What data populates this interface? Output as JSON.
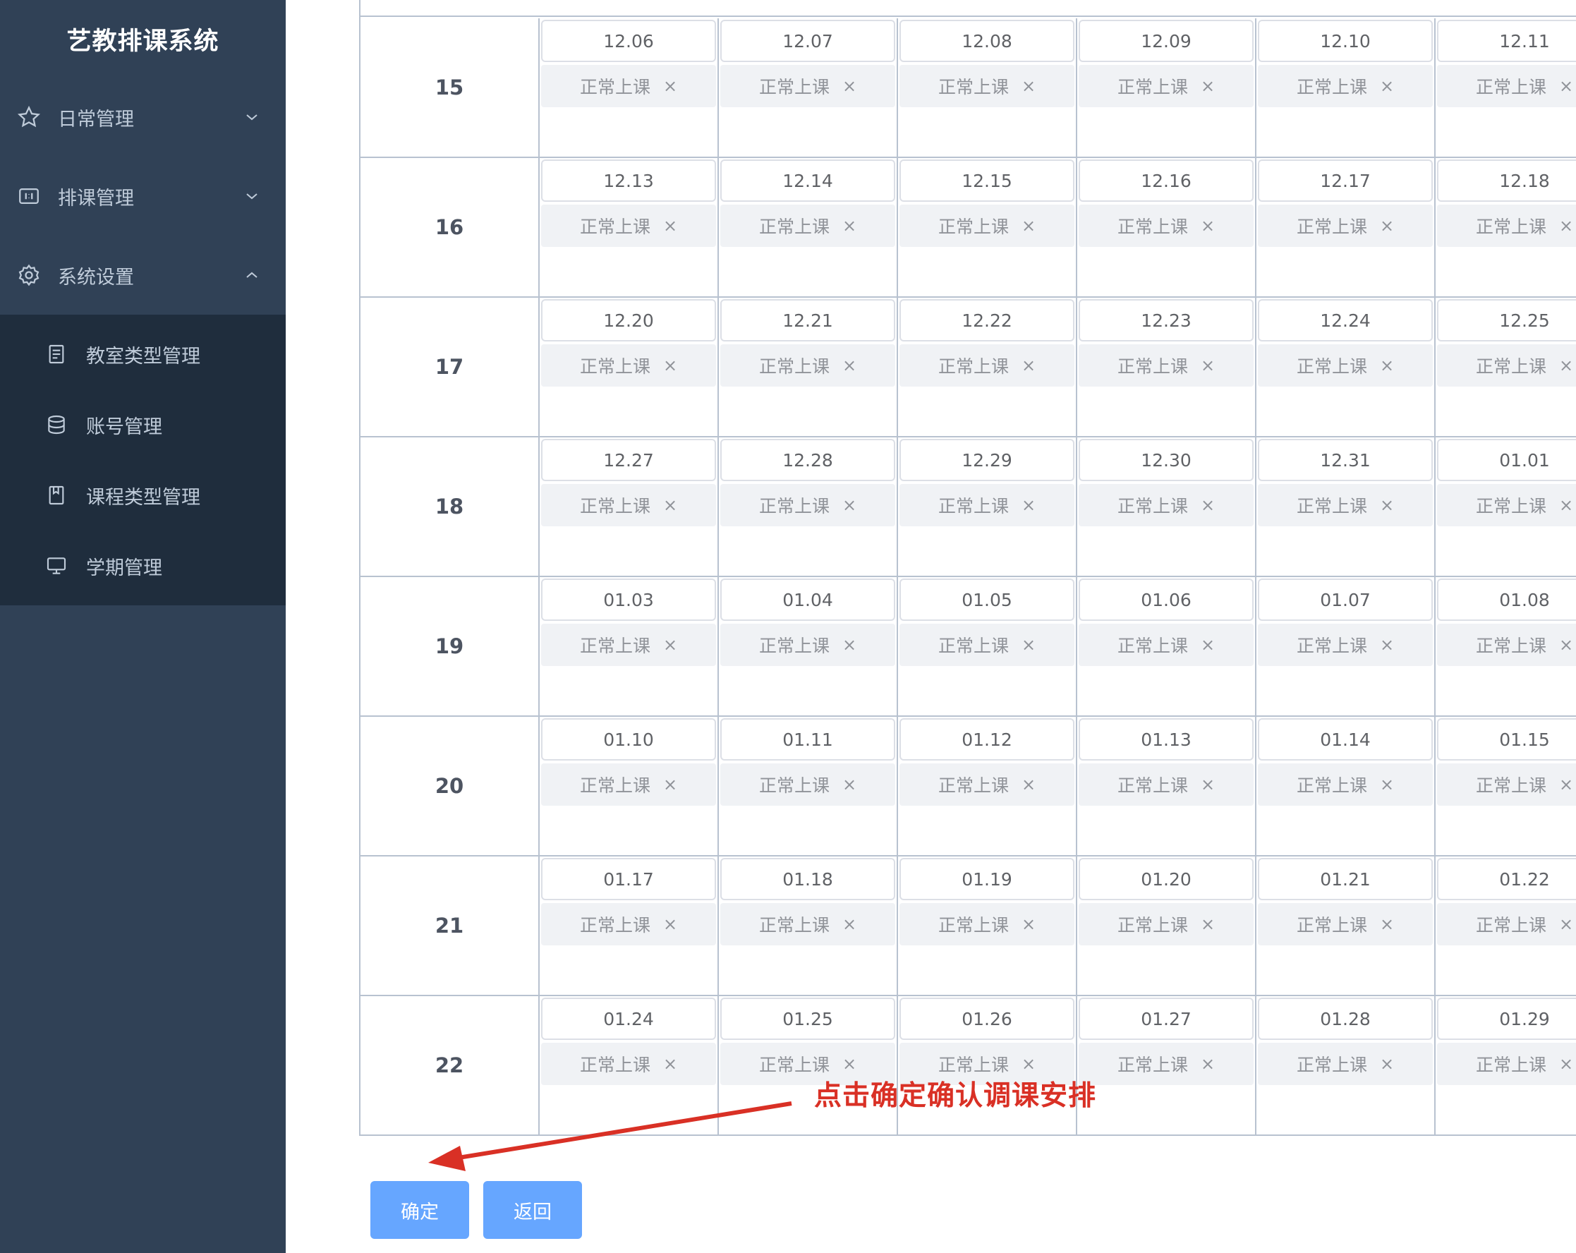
{
  "app": {
    "title": "艺教排课系统"
  },
  "sidebar": {
    "menus": [
      {
        "label": "日常管理",
        "icon": "star-icon",
        "expanded": false
      },
      {
        "label": "排课管理",
        "icon": "schedule-icon",
        "expanded": false
      },
      {
        "label": "系统设置",
        "icon": "gear-icon",
        "expanded": true
      }
    ],
    "submenu": [
      {
        "label": "教室类型管理",
        "icon": "document-icon"
      },
      {
        "label": "账号管理",
        "icon": "database-icon"
      },
      {
        "label": "课程类型管理",
        "icon": "book-icon"
      },
      {
        "label": "学期管理",
        "icon": "monitor-icon"
      }
    ]
  },
  "schedule": {
    "rows": [
      {
        "week": "15",
        "dates": [
          "12.06",
          "12.07",
          "12.08",
          "12.09",
          "12.10",
          "12.11"
        ]
      },
      {
        "week": "16",
        "dates": [
          "12.13",
          "12.14",
          "12.15",
          "12.16",
          "12.17",
          "12.18"
        ]
      },
      {
        "week": "17",
        "dates": [
          "12.20",
          "12.21",
          "12.22",
          "12.23",
          "12.24",
          "12.25"
        ]
      },
      {
        "week": "18",
        "dates": [
          "12.27",
          "12.28",
          "12.29",
          "12.30",
          "12.31",
          "01.01"
        ]
      },
      {
        "week": "19",
        "dates": [
          "01.03",
          "01.04",
          "01.05",
          "01.06",
          "01.07",
          "01.08"
        ]
      },
      {
        "week": "20",
        "dates": [
          "01.10",
          "01.11",
          "01.12",
          "01.13",
          "01.14",
          "01.15"
        ]
      },
      {
        "week": "21",
        "dates": [
          "01.17",
          "01.18",
          "01.19",
          "01.20",
          "01.21",
          "01.22"
        ]
      },
      {
        "week": "22",
        "dates": [
          "01.24",
          "01.25",
          "01.26",
          "01.27",
          "01.28",
          "01.29"
        ]
      }
    ],
    "tag_label": "正常上课",
    "tag_close": "×"
  },
  "actions": {
    "confirm_label": "确定",
    "back_label": "返回"
  },
  "annotation": {
    "text": "点击确定确认调课安排",
    "color": "#d93025"
  }
}
